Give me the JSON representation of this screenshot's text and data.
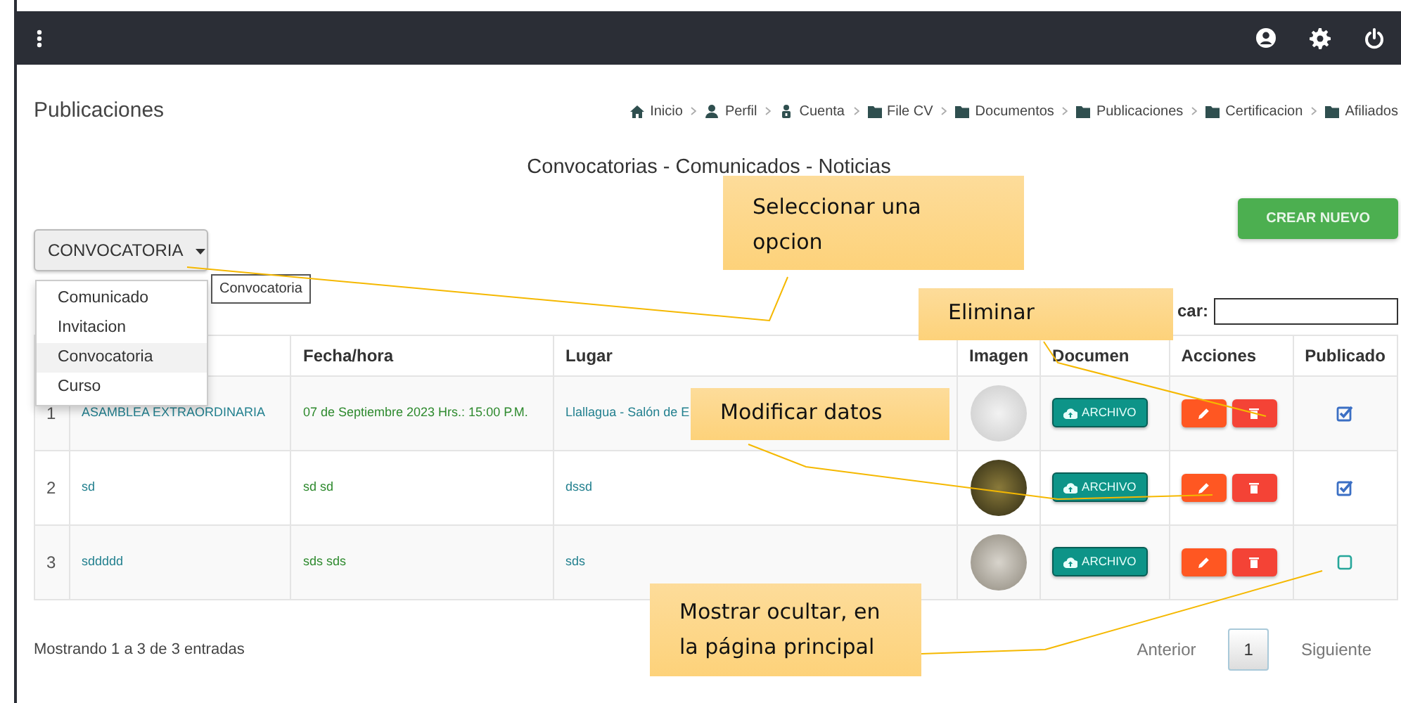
{
  "page_title": "Publicaciones",
  "breadcrumb": [
    {
      "label": "Inicio",
      "kind": "home"
    },
    {
      "label": "Perfil",
      "kind": "person"
    },
    {
      "label": "Cuenta",
      "kind": "account"
    },
    {
      "label": "File CV",
      "kind": "folder"
    },
    {
      "label": "Documentos",
      "kind": "folder"
    },
    {
      "label": "Publicaciones",
      "kind": "folder"
    },
    {
      "label": "Certificacion",
      "kind": "folder"
    },
    {
      "label": "Afiliados",
      "kind": "folder"
    }
  ],
  "section_title": "Convocatorias - Comunicados - Noticias",
  "type_dropdown": {
    "label": "CONVOCATORIA",
    "tooltip": "Convocatoria",
    "options": [
      {
        "label": "Comunicado",
        "selected": false
      },
      {
        "label": "Invitacion",
        "selected": false
      },
      {
        "label": "Convocatoria",
        "selected": true
      },
      {
        "label": "Curso",
        "selected": false
      }
    ]
  },
  "create_button": "CREAR NUEVO",
  "search_label": "car:",
  "table": {
    "columns": [
      "",
      "",
      "Fecha/hora",
      "Lugar",
      "Imagen",
      "Documen",
      "Acciones",
      "Publicado"
    ],
    "rows": [
      {
        "number": "1",
        "title": "ASAMBLEA EXTRAORDINARIA",
        "date": "07 de Septiembre 2023 Hrs.: 15:00 P.M.",
        "place": "Llallagua - Salón de E",
        "document": "ARCHIVO",
        "published": true
      },
      {
        "number": "2",
        "title": "sd",
        "date": "sd sd",
        "place": "dssd",
        "document": "ARCHIVO",
        "published": true
      },
      {
        "number": "3",
        "title": "sddddd",
        "date": "sds sds",
        "place": "sds",
        "document": "ARCHIVO",
        "published": false
      }
    ]
  },
  "footer_info": "Mostrando 1 a 3 de 3 entradas",
  "pagination": [
    {
      "label": "Anterior",
      "selected": false
    },
    {
      "label": "1",
      "selected": true
    },
    {
      "label": "Siguiente",
      "selected": false
    }
  ],
  "callouts": [
    "Seleccionar una opcion",
    "Eliminar",
    "Modificar datos",
    "Mostrar ocultar, en la página principal"
  ]
}
